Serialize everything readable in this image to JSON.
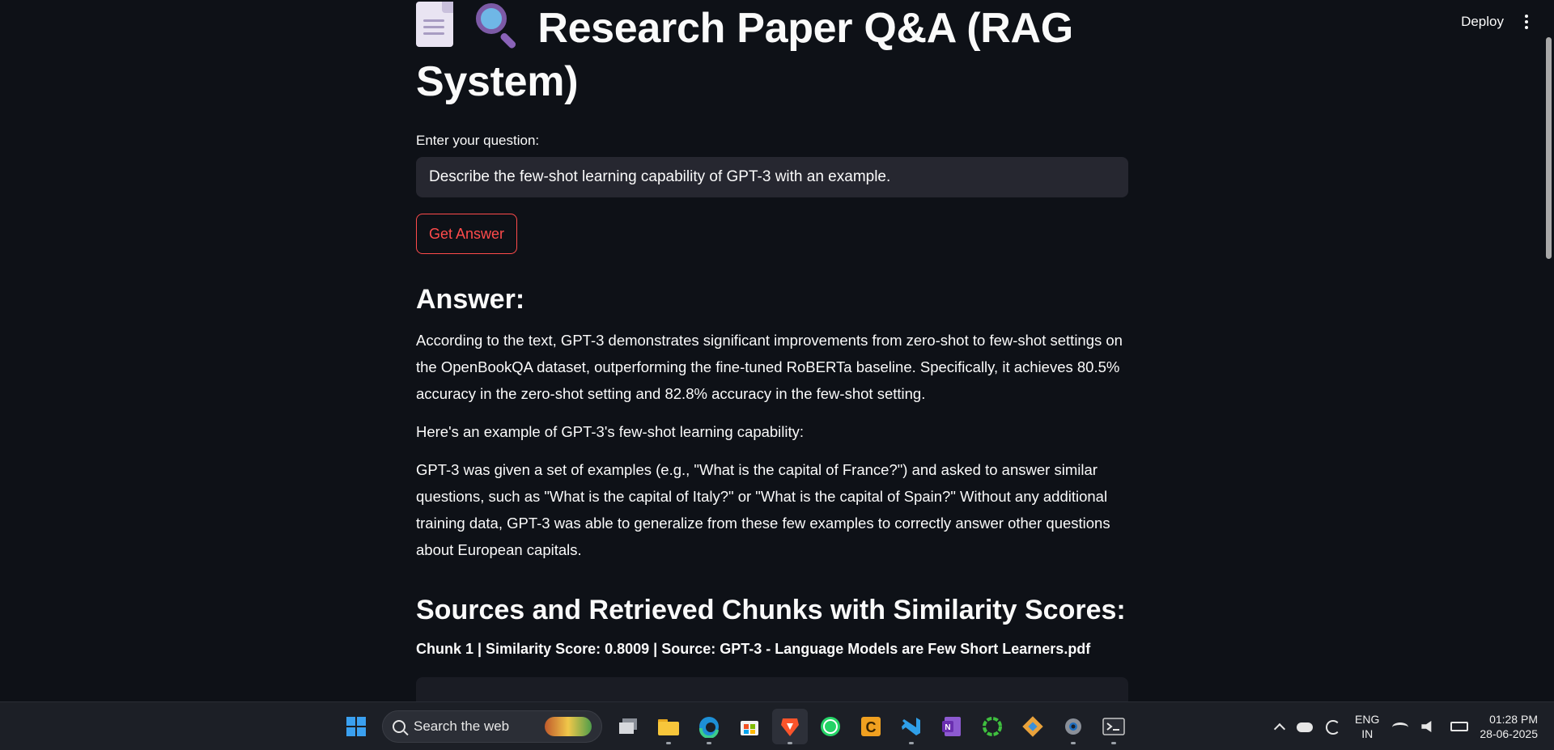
{
  "header": {
    "deploy_label": "Deploy",
    "menu_icon": "kebab-menu-icon"
  },
  "page": {
    "title": "Research Paper Q&A (RAG System)",
    "title_icons": [
      "document-icon",
      "magnifier-icon"
    ]
  },
  "question": {
    "label": "Enter your question:",
    "value": "Describe the few-shot learning capability of GPT-3 with an example."
  },
  "get_answer_label": "Get Answer",
  "answer": {
    "heading": "Answer:",
    "paragraphs": [
      "According to the text, GPT-3 demonstrates significant improvements from zero-shot to few-shot settings on the OpenBookQA dataset, outperforming the fine-tuned RoBERTa baseline. Specifically, it achieves 80.5% accuracy in the zero-shot setting and 82.8% accuracy in the few-shot setting.",
      "Here's an example of GPT-3's few-shot learning capability:",
      "GPT-3 was given a set of examples (e.g., \"What is the capital of France?\") and asked to answer similar questions, such as \"What is the capital of Italy?\" or \"What is the capital of Spain?\" Without any additional training data, GPT-3 was able to generalize from these few examples to correctly answer other questions about European capitals."
    ]
  },
  "sources": {
    "heading": "Sources and Retrieved Chunks with Similarity Scores:",
    "chunks": [
      {
        "label": "Chunk 1 | Similarity Score: 0.8009 | Source: GPT-3 - Language Models are Few Short Learners.pdf"
      }
    ]
  },
  "taskbar": {
    "search_placeholder": "Search the web",
    "apps": [
      "windows-start-icon",
      "task-view-icon",
      "file-explorer-icon",
      "edge-icon",
      "store-icon",
      "brave-icon",
      "whatsapp-icon",
      "c-app-icon",
      "vscode-icon",
      "onenote-icon",
      "circle-app-icon",
      "git-icon",
      "settings-icon",
      "terminal-icon"
    ],
    "tray": {
      "lang_line1": "ENG",
      "lang_line2": "IN",
      "time": "01:28 PM",
      "date": "28-06-2025"
    }
  },
  "colors": {
    "background": "#0e1117",
    "accent": "#ff4b4b",
    "input_bg": "#262730"
  }
}
